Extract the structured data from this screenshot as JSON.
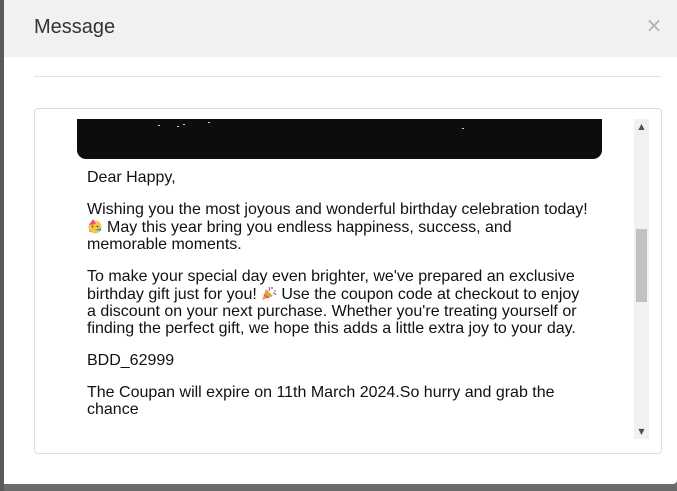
{
  "dialog": {
    "title": "Message",
    "close_glyph": "×"
  },
  "message": {
    "greeting": "Dear Happy,",
    "paragraph1_line1": "Wishing you the most joyous and wonderful birthday celebration today!",
    "paragraph1_line2": "May this year bring you endless happiness, success, and",
    "paragraph1_line3": "memorable moments.",
    "paragraph2_line1": "To make your special day even brighter, we've prepared an exclusive",
    "paragraph2_line2a": "birthday gift just for you!",
    "paragraph2_line2b": "Use the coupon code at checkout to enjoy",
    "paragraph2_line3": "a discount on your next purchase. Whether you're treating yourself or",
    "paragraph2_line4": "finding the perfect gift, we hope this adds a little extra joy to your day.",
    "coupon_code": "BDD_62999",
    "expiry_line1": "The Coupan will expire on 11th March 2024.So hurry and grab the",
    "expiry_line2": "chance"
  },
  "icons": {
    "party_face": "partying-face-emoji",
    "party_popper": "party-popper-emoji",
    "scroll_up": "▲",
    "scroll_down": "▼"
  },
  "scroll": {
    "position_fraction": 0.33
  },
  "colors": {
    "header_bg": "#f1f1f1",
    "backdrop": "#6b6b6b",
    "banner": "#0d0d0d",
    "scroll_thumb": "#c1c1c1"
  }
}
